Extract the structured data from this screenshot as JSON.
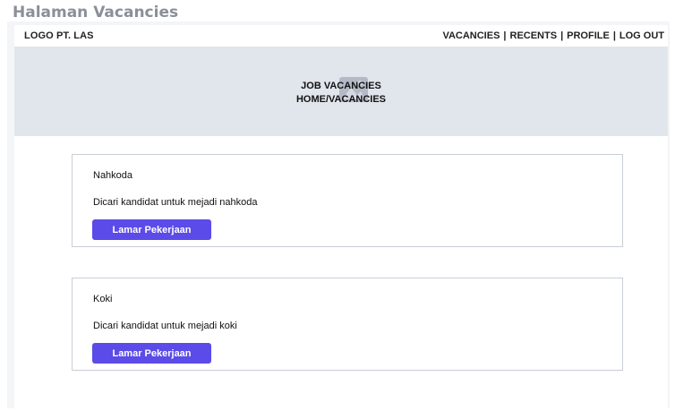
{
  "page": {
    "frame_label": "Halaman Vacancies"
  },
  "header": {
    "logo": "LOGO PT. LAS",
    "nav": [
      {
        "label": "VACANCIES"
      },
      {
        "label": "RECENTS"
      },
      {
        "label": "PROFILE"
      },
      {
        "label": "LOG OUT"
      }
    ],
    "separator": "|"
  },
  "hero": {
    "title": "JOB VACANCIES",
    "breadcrumb": "HOME/VACANCIES",
    "icon": "image-placeholder-icon"
  },
  "jobs": [
    {
      "title": "Nahkoda",
      "description": "Dicari kandidat untuk mejadi nahkoda",
      "button": "Lamar Pekerjaan"
    },
    {
      "title": "Koki",
      "description": "Dicari kandidat untuk mejadi koki",
      "button": "Lamar Pekerjaan"
    }
  ],
  "colors": {
    "button": "#5b4be8",
    "hero_bg": "#e1e5ec",
    "canvas_bg": "#f4f5f7"
  }
}
